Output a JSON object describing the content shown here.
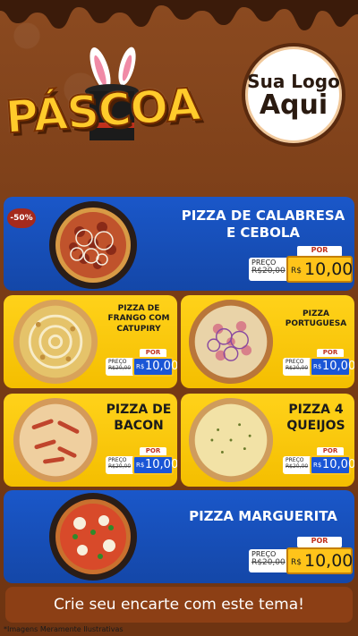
{
  "header": {
    "title": "PÁSCOA",
    "logo_line1": "Sua Logo",
    "logo_line2": "Aqui"
  },
  "badge": "-50%",
  "items": [
    {
      "name": "PIZZA DE CALABRESA\nE CEBOLA",
      "por": "POR",
      "preco": "PREÇO",
      "old": "R$20,00",
      "rs": "R$",
      "value": "10,00"
    },
    {
      "name": "PIZZA DE\nFRANGO COM\nCATUPIRY",
      "por": "POR",
      "preco": "PREÇO",
      "old": "R$20,00",
      "rs": "R$",
      "value": "10,00"
    },
    {
      "name": "PIZZA\nPORTUGUESA",
      "por": "POR",
      "preco": "PREÇO",
      "old": "R$20,00",
      "rs": "R$",
      "value": "10,00"
    },
    {
      "name": "PIZZA DE\nBACON",
      "por": "POR",
      "preco": "PREÇO",
      "old": "R$20,00",
      "rs": "R$",
      "value": "10,00"
    },
    {
      "name": "PIZZA 4\nQUEIJOS",
      "por": "POR",
      "preco": "PREÇO",
      "old": "R$20,00",
      "rs": "R$",
      "value": "10,00"
    },
    {
      "name": "PIZZA MARGUERITA",
      "por": "POR",
      "preco": "PREÇO",
      "old": "R$20,00",
      "rs": "R$",
      "value": "10,00"
    }
  ],
  "footer": {
    "cta": "Crie seu encarte com este tema!",
    "note": "*Imagens Meramente Ilustrativas"
  },
  "colors": {
    "blue": "#1a57c9",
    "yellow": "#ffd21a",
    "brown": "#7a3d17"
  }
}
